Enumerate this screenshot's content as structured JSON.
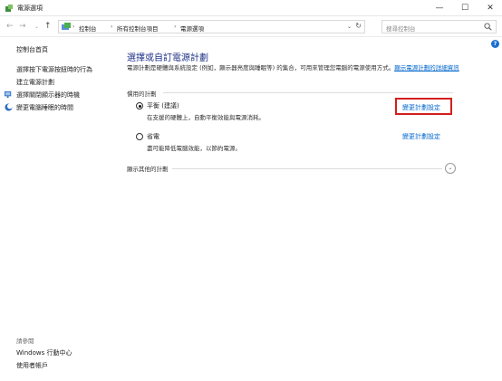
{
  "window": {
    "title": "電源選項",
    "minimize": "—",
    "maximize": "☐",
    "close": "✕"
  },
  "nav": {
    "back": "←",
    "forward": "→",
    "dropdown": "⌄",
    "up": "↑",
    "breadcrumb": [
      "控制台",
      "所有控制台項目",
      "電源選項"
    ],
    "breadcrumb_sep": "›",
    "refresh": "↻",
    "search_placeholder": "搜尋控制台"
  },
  "sidebar": {
    "home": "控制台首頁",
    "items": [
      "選擇按下電源按鈕時的行為",
      "建立電源計劃",
      "選擇關閉顯示器的時機",
      "變更電腦睡眠的時間"
    ],
    "see_also_title": "請參閱",
    "see_also": [
      "Windows 行動中心",
      "使用者帳戶"
    ]
  },
  "help": "?",
  "main": {
    "title": "選擇或自訂電源計劃",
    "description": "電源計劃是硬體與系統設定 (例如，顯示器亮度與睡眠等) 的集合，可用來管理您電腦的電源使用方式。",
    "description_link": "顯示電源計劃的詳細資訊",
    "preferred_heading": "慣用的計劃",
    "plans": [
      {
        "name": "平衡 (建議)",
        "desc": "在支援的硬體上，自動平衡效能與電源消耗。",
        "link": "變更計劃設定",
        "selected": true
      },
      {
        "name": "省電",
        "desc": "盡可能降低電腦效能，以節約電源。",
        "link": "變更計劃設定",
        "selected": false
      }
    ],
    "more_plans": "顯示其他的計劃",
    "expand": "⌄"
  },
  "colors": {
    "title": "#1e3287",
    "link": "#0066cc",
    "highlight": "#d31f1f"
  }
}
